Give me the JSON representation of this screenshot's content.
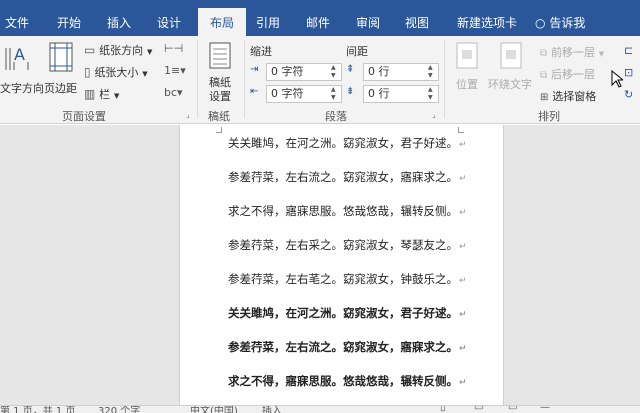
{
  "tabs": [
    "文件",
    "开始",
    "插入",
    "设计",
    "布局",
    "引用",
    "邮件",
    "审阅",
    "视图",
    "新建选项卡"
  ],
  "tell_me": "告诉我",
  "ribbon": {
    "text_direction": "文字方向",
    "margins": "页边距",
    "orientation": "纸张方向",
    "size": "纸张大小",
    "columns": "栏",
    "page_setup_label": "页面设置",
    "manuscript": "稿纸",
    "manuscript_settings": "设置",
    "manuscript_group": "稿纸",
    "indent_label": "缩进",
    "spacing_label": "间距",
    "indent_left": "0 字符",
    "indent_right": "0 字符",
    "spacing_before": "0 行",
    "spacing_after": "0 行",
    "paragraph_label": "段落",
    "position": "位置",
    "wrap_text": "环绕文字",
    "bring_forward": "前移一层",
    "send_backward": "后移一层",
    "selection_pane": "选择窗格",
    "arrange_label": "排列"
  },
  "document": {
    "lines": [
      {
        "text": "关关雎鸠，在河之洲。窈窕淑女，君子好逑。",
        "bold": false
      },
      {
        "text": "参差荇菜，左右流之。窈窕淑女，寤寐求之。",
        "bold": false
      },
      {
        "text": "求之不得，寤寐思服。悠哉悠哉，辗转反侧。",
        "bold": false
      },
      {
        "text": "参差荇菜，左右采之。窈窕淑女，琴瑟友之。",
        "bold": false
      },
      {
        "text": "参差荇菜，左右芼之。窈窕淑女，钟鼓乐之。",
        "bold": false
      },
      {
        "text": "关关雎鸠，在河之洲。窈窕淑女，君子好逑。",
        "bold": true
      },
      {
        "text": "参差荇菜，左右流之。窈窕淑女，寤寐求之。",
        "bold": true
      },
      {
        "text": "求之不得，寤寐思服。悠哉悠哉，辗转反侧。",
        "bold": true
      }
    ]
  },
  "status": {
    "page": "第 1 页，共 1 页",
    "words": "320 个字",
    "language": "中文(中国)",
    "mode": "插入"
  },
  "colors": {
    "tab_bar": "#2b579a",
    "ribbon": "#f3f3f3",
    "doc_bg": "#e6e6e6"
  }
}
